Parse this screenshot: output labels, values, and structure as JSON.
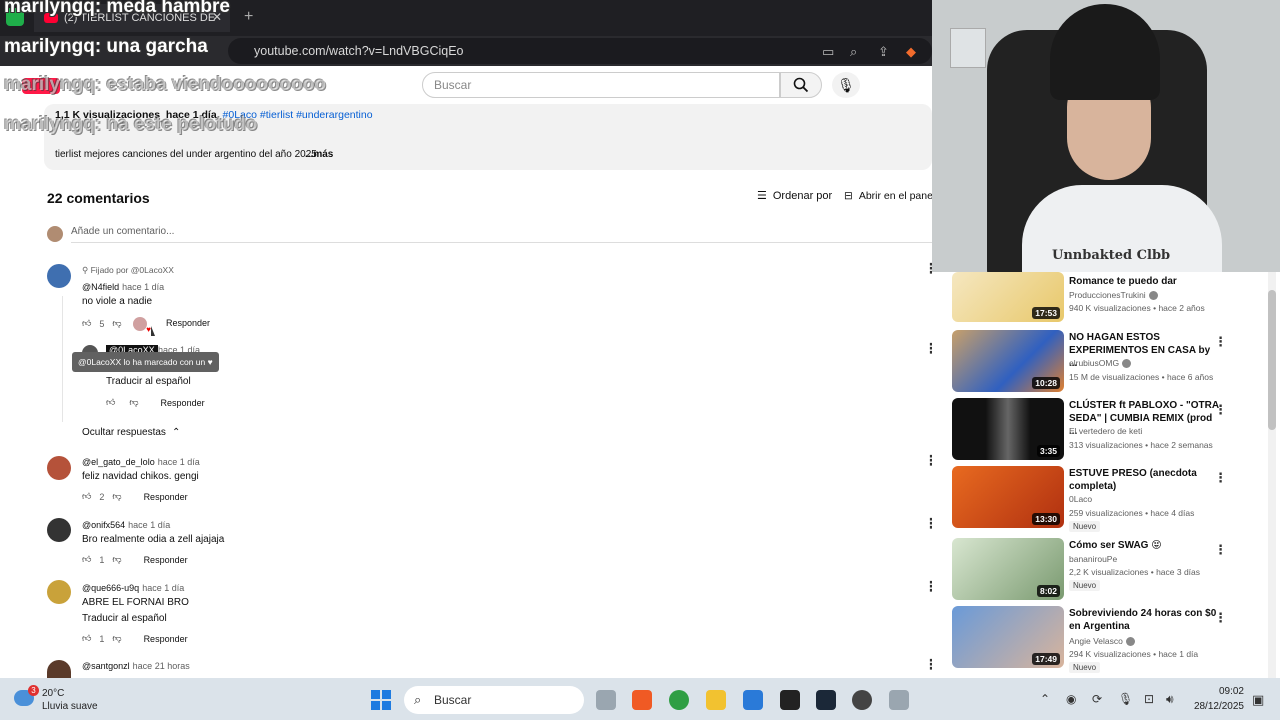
{
  "browser": {
    "tab_title": "(2) TIERLIST CANCIONES DE",
    "url": "youtube.com/watch?v=LndVBGCiqEo"
  },
  "youtube": {
    "search_placeholder": "Buscar",
    "video_meta": {
      "views": "1,1 K visualizaciones",
      "age": "hace 1 día",
      "tags": "#0Laco #tierlist #underargentino"
    },
    "description": "tierlist mejores canciones del under argentino del año 2025",
    "more": "...más",
    "comments_count": "22 comentarios",
    "sort_label": "Ordenar por",
    "panel_label": "Abrir en el panel",
    "add_comment_placeholder": "Añade un comentario...",
    "pinned_label": "Fijado por @0LacoXX",
    "tooltip": "@0LacoXX lo ha marcado con un ♥",
    "reply_label": "Responder",
    "translate_label": "Traducir al español",
    "hide_replies": "Ocultar respuestas",
    "comments": [
      {
        "author": "@N4field",
        "time": "hace 1 día",
        "text": "no viole a nadie",
        "likes": "5"
      },
      {
        "author": "@el_gato_de_lolo",
        "time": "hace 1 día",
        "text": "feliz navidad chikos. gengi",
        "likes": "2"
      },
      {
        "author": "@onifx564",
        "time": "hace 1 día",
        "text": "Bro realmente odia a zell ajajaja",
        "likes": "1"
      },
      {
        "author": "@que666-u9q",
        "time": "hace 1 día",
        "text": "ABRE EL FORNAI BRO",
        "likes": "1"
      },
      {
        "author": "@santgonzl",
        "time": "hace 21 horas",
        "text": "",
        "likes": ""
      }
    ],
    "reply": {
      "author": "@0LacoXX",
      "time": "hace 1 día"
    }
  },
  "chat_overlay": [
    {
      "user": "marilyngq",
      "msg": "meda hambre"
    },
    {
      "user": "marilyngq",
      "msg": "una garcha"
    },
    {
      "user": "marilyngq",
      "msg": "estaba viendooooooooo"
    },
    {
      "user": "marilyngq",
      "msg": "na este pelotudo"
    }
  ],
  "webcam": {
    "shirt_text": "Unnbakted Clbb"
  },
  "sidebar": {
    "recommendations": [
      {
        "title": "Romance te puedo dar",
        "channel": "ProduccionesTrukini",
        "verified": true,
        "meta": "940 K visualizaciones • hace 2 años",
        "duration": "17:53",
        "new": false
      },
      {
        "title": "NO HAGAN ESTOS EXPERIMENTOS EN CASA by ...",
        "channel": "elrubiusOMG",
        "verified": true,
        "meta": "15 M de visualizaciones • hace 6 años",
        "duration": "10:28",
        "new": false
      },
      {
        "title": "CLÚSTER ft PABLOXO - \"OTRA SEDA\" | CUMBIA REMIX (prod ...",
        "channel": "El vertedero de keti",
        "verified": false,
        "meta": "313 visualizaciones • hace 2 semanas",
        "duration": "3:35",
        "new": false
      },
      {
        "title": "ESTUVE PRESO (anecdota completa)",
        "channel": "0Laco",
        "verified": false,
        "meta": "259 visualizaciones • hace 4 días",
        "duration": "13:30",
        "new": true
      },
      {
        "title": "Cómo ser SWAG 😝",
        "channel": "bananirouPe",
        "verified": false,
        "meta": "2,2 K visualizaciones • hace 3 días",
        "duration": "8:02",
        "new": true
      },
      {
        "title": "Sobreviviendo 24 horas con $0 en Argentina",
        "channel": "Angie Velasco",
        "verified": true,
        "meta": "294 K visualizaciones • hace 1 día",
        "duration": "17:49",
        "new": true
      }
    ],
    "new_label": "Nuevo"
  },
  "taskbar": {
    "temperature": "20°C",
    "condition": "Lluvia suave",
    "weather_badge": "3",
    "search": "Buscar",
    "time": "09:02",
    "date": "28/12/2025"
  },
  "colors": {
    "accent": "#ff0033",
    "link": "#065fd4",
    "taskbar": "#dbe3ea"
  }
}
